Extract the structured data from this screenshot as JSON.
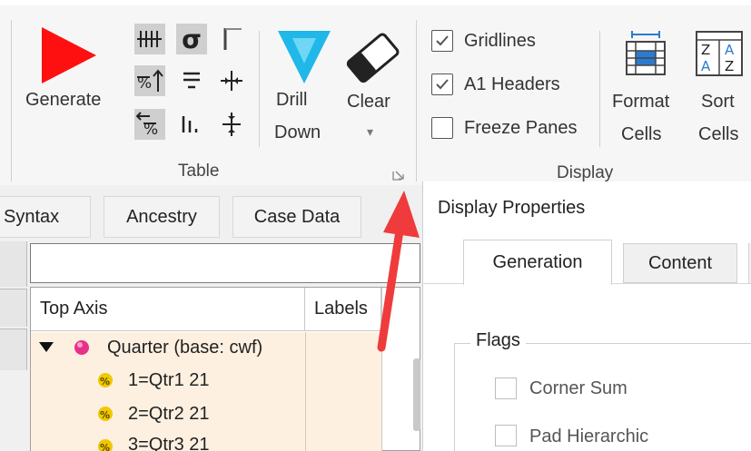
{
  "ribbon": {
    "generate_label": "Generate",
    "drill": {
      "line1": "Drill",
      "line2": "Down"
    },
    "clear": {
      "line1": "Clear",
      "dropdown_glyph": "▾"
    },
    "table_group_label": "Table",
    "display_group_label": "Display",
    "checks": [
      {
        "label": "Gridlines",
        "checked": true
      },
      {
        "label": "A1 Headers",
        "checked": true
      },
      {
        "label": "Freeze Panes",
        "checked": false
      }
    ],
    "format_cells": {
      "line1": "Format",
      "line2": "Cells"
    },
    "sort_cells": {
      "line1": "Sort",
      "line2": "Cells",
      "icon_text": [
        "Z",
        "A",
        "A",
        "Z"
      ]
    },
    "table_tools": [
      {
        "name": "lines-tool-icon",
        "glyph": "ᚔ",
        "active": true
      },
      {
        "name": "sigma-tool-icon",
        "glyph": "σ",
        "active": true
      },
      {
        "name": "corner-tool-icon",
        "glyph": "⌜",
        "active": false
      },
      {
        "name": "percent-up-tool-icon",
        "glyph": "%",
        "active": true
      },
      {
        "name": "equals-tool-icon",
        "glyph": "≡",
        "active": false
      },
      {
        "name": "cross-tool-icon",
        "glyph": "✢",
        "active": false
      },
      {
        "name": "percent-down-tool-icon",
        "glyph": "%",
        "active": true
      },
      {
        "name": "bars-tool-icon",
        "glyph": "⦙",
        "active": false
      },
      {
        "name": "split-tool-icon",
        "glyph": "✣",
        "active": false
      }
    ]
  },
  "left_tabs": [
    "Syntax",
    "Ancestry",
    "Case Data"
  ],
  "grid": {
    "columns": [
      "Top Axis",
      "Labels"
    ],
    "rows": [
      {
        "text": "Quarter (base: cwf)",
        "kind": "parent"
      },
      {
        "text": "1=Qtr1 21",
        "kind": "child"
      },
      {
        "text": "2=Qtr2 21",
        "kind": "child"
      },
      {
        "text": "3=Qtr3 21",
        "kind": "child"
      }
    ]
  },
  "dialog": {
    "title": "Display Properties",
    "tabs": [
      "Generation",
      "Content"
    ],
    "flags_label": "Flags",
    "flags": [
      {
        "label": "Corner Sum",
        "checked": false
      },
      {
        "label": "Pad Hierarchic",
        "checked": false
      }
    ]
  },
  "colors": {
    "generate_red": "#ff1010",
    "drill_cyan": "#1fb8e8",
    "annotation_arrow": "#ef3b3b",
    "grid_bg": "#fdf0e0",
    "bullet_pink": "#e8308a",
    "bullet_yellow": "#f0c800"
  }
}
